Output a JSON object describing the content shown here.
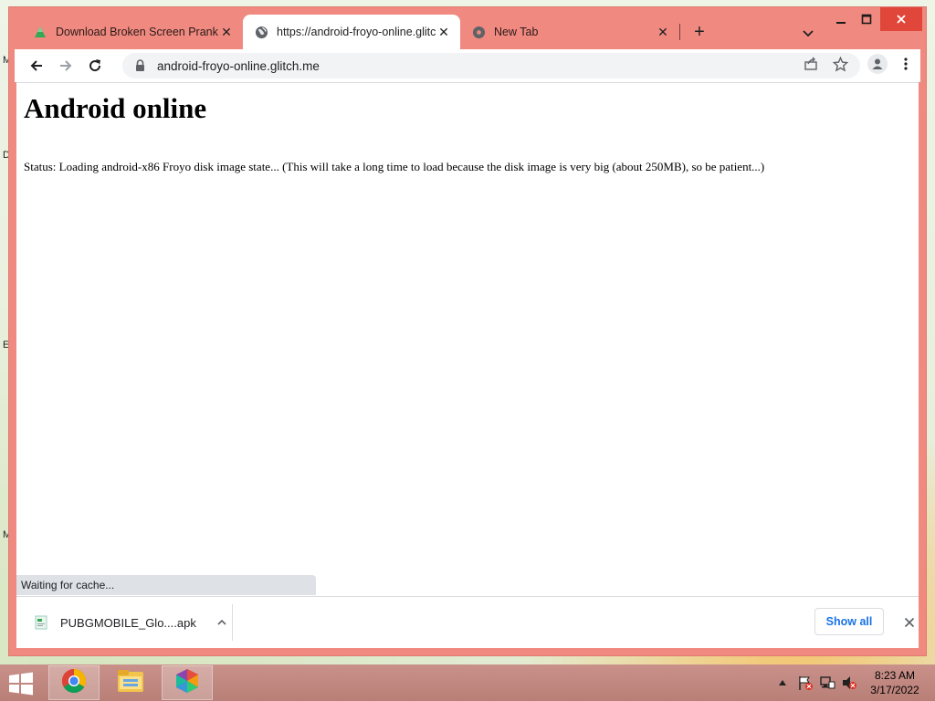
{
  "browser": {
    "tabs": [
      {
        "title": "Download Broken Screen Prank f",
        "icon": "play-triangle-icon"
      },
      {
        "title": "https://android-froyo-online.glitc",
        "icon": "globe-icon"
      },
      {
        "title": "New Tab",
        "icon": "chrome-icon"
      }
    ],
    "close_glyph": "✕",
    "newtab_glyph": "+",
    "address": "android-froyo-online.glitch.me"
  },
  "page": {
    "heading": "Android online",
    "status": "Status: Loading android-x86 Froyo disk image state... (This will take a long time to load because the disk image is very big (about 250MB), so be patient...)"
  },
  "status_bubble": "Waiting for cache...",
  "downloads": {
    "file_name": "PUBGMOBILE_Glo....apk",
    "show_all_label": "Show all"
  },
  "desktop_letters": [
    "M",
    "D",
    "E",
    "M"
  ],
  "taskbar": {
    "apps": [
      "chrome-icon",
      "file-explorer-icon",
      "photos-icon"
    ],
    "time": "8:23 AM",
    "date": "3/17/2022"
  },
  "colors": {
    "window_frame": "#f08a80",
    "close_button": "#e0473a",
    "link_blue": "#1a73e8"
  }
}
